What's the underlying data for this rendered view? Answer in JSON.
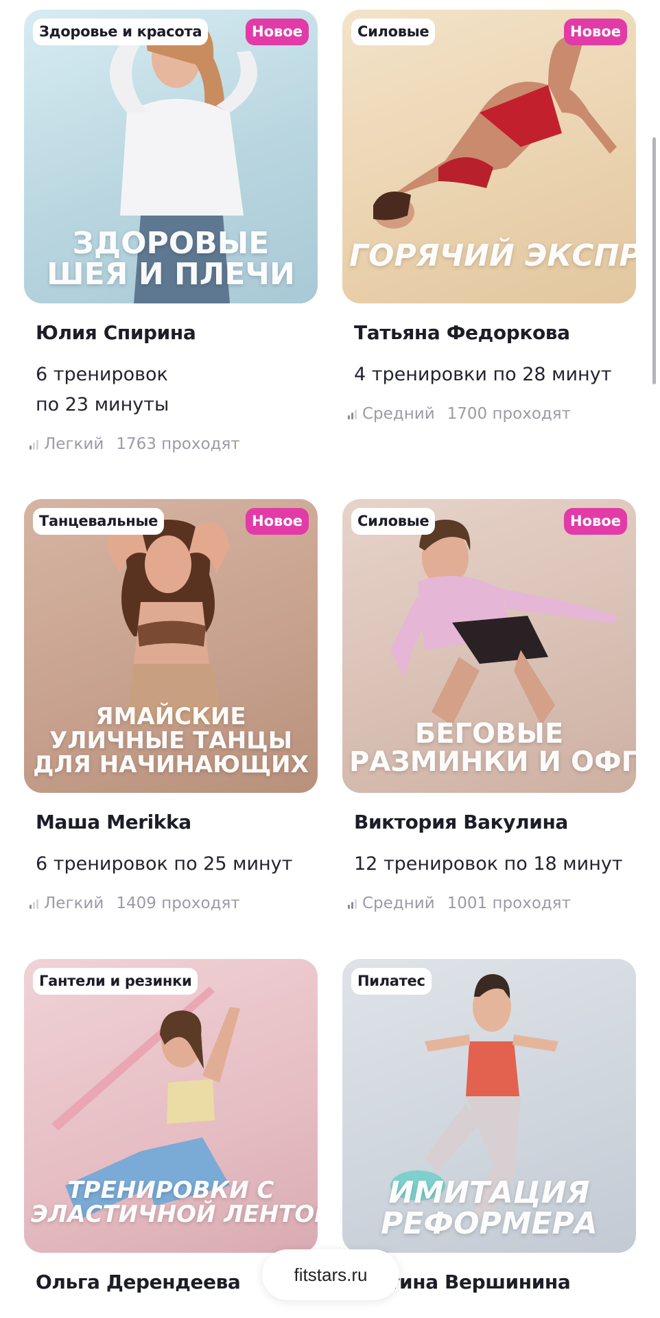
{
  "cards": [
    {
      "category": "Здоровье и красота",
      "badge": "Новое",
      "cover_line1": "ЗДОРОВЫЕ",
      "cover_line2": "ШЕЯ И ПЛЕЧИ",
      "coach": "Юлия Спирина",
      "workouts_line1": "6 тренировок",
      "workouts_line2": "по 23 минуты",
      "level": "Легкий",
      "participants": "1763 проходят",
      "bg_color": "#c3dde7"
    },
    {
      "category": "Силовые",
      "badge": "Новое",
      "cover_line1": "ГОРЯЧИЙ ЭКСПРЕСС",
      "coach": "Татьяна Федоркова",
      "workouts_line1": "4 тренировки по 28 минут",
      "level": "Средний",
      "participants": "1700 проходят",
      "bg_color": "#ecd7b7"
    },
    {
      "category": "Танцевальные",
      "badge": "Новое",
      "cover_line1": "ЯМАЙСКИЕ",
      "cover_line2": "УЛИЧНЫЕ ТАНЦЫ",
      "cover_line3": "ДЛЯ НАЧИНАЮЩИХ",
      "coach": "Маша Merikka",
      "workouts_line1": "6 тренировок по 25 минут",
      "level": "Легкий",
      "participants": "1409 проходят",
      "bg_color": "#c9a593"
    },
    {
      "category": "Силовые",
      "badge": "Новое",
      "cover_line1": "БЕГОВЫЕ",
      "cover_line2": "РАЗМИНКИ И ОФП",
      "coach": "Виктория Вакулина",
      "workouts_line1": "12 тренировок по 18 минут",
      "level": "Средний",
      "participants": "1001 проходят",
      "bg_color": "#d9c2b7"
    },
    {
      "category": "Гантели и резинки",
      "cover_line1": "ТРЕНИРОВКИ С",
      "cover_line2": "ЭЛАСТИЧНОЙ ЛЕНТОЙ",
      "coach": "Ольга Дерендеева",
      "bg_color": "#e5c1c6"
    },
    {
      "category": "Пилатес",
      "cover_line1": "ИМИТАЦИЯ",
      "cover_line2": "РЕФОРМЕРА",
      "coach": "стина Вершинина",
      "bg_color": "#d0d6de"
    }
  ],
  "domain": "fitstars.ru",
  "colors": {
    "badge": "#e23ba7",
    "text": "#1d1d28",
    "muted": "#9b9ba6"
  },
  "level_icon": "signal-bars-icon"
}
